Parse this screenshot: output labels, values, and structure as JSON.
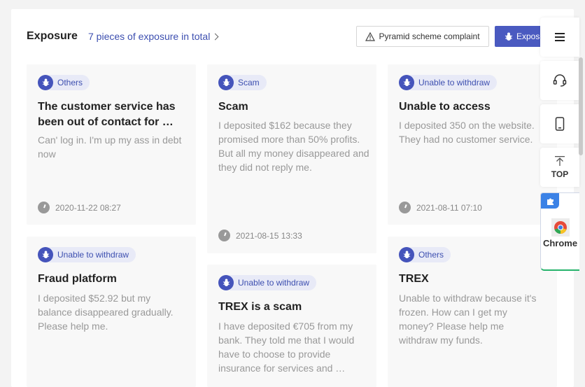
{
  "header": {
    "title": "Exposure",
    "total_link": "7 pieces of exposure in total",
    "pyramid_button": "Pyramid scheme complaint",
    "expose_button": "Exposure"
  },
  "cards": [
    {
      "tag": "Others",
      "title": "The customer service has been out of contact for …",
      "body": "Can' log in. I'm up my ass in debt now",
      "time": "2020-11-22 08:27"
    },
    {
      "tag": "Scam",
      "title": "Scam",
      "body": "I deposited $162 because they promised more than 50% profits. But all my money disappeared and they did not reply me.",
      "time": "2021-08-15 13:33"
    },
    {
      "tag": "Unable to withdraw",
      "title": "Unable to access",
      "body": "I deposited 350 on the website. They had no customer service.",
      "time": "2021-08-11 07:10"
    },
    {
      "tag": "Unable to withdraw",
      "title": "Fraud platform",
      "body": "I deposited $52.92 but my balance disappeared gradually. Please help me.",
      "time": ""
    },
    {
      "tag": "Unable to withdraw",
      "title": "TREX is a scam",
      "body": "I have deposited €705 from my bank. They told me that I would have to choose to provide insurance for services and …",
      "time": ""
    },
    {
      "tag": "Others",
      "title": "TREX",
      "body": "Unable to withdraw because it's frozen. How can I get my money? Please help me withdraw my funds.",
      "time": ""
    }
  ],
  "sidebar": {
    "top_label": "TOP",
    "chrome_label": "Chrome"
  },
  "colors": {
    "accent": "#4a5ac0",
    "tag_bg": "#e8eaf7",
    "chrome_border": "#26b36b"
  }
}
